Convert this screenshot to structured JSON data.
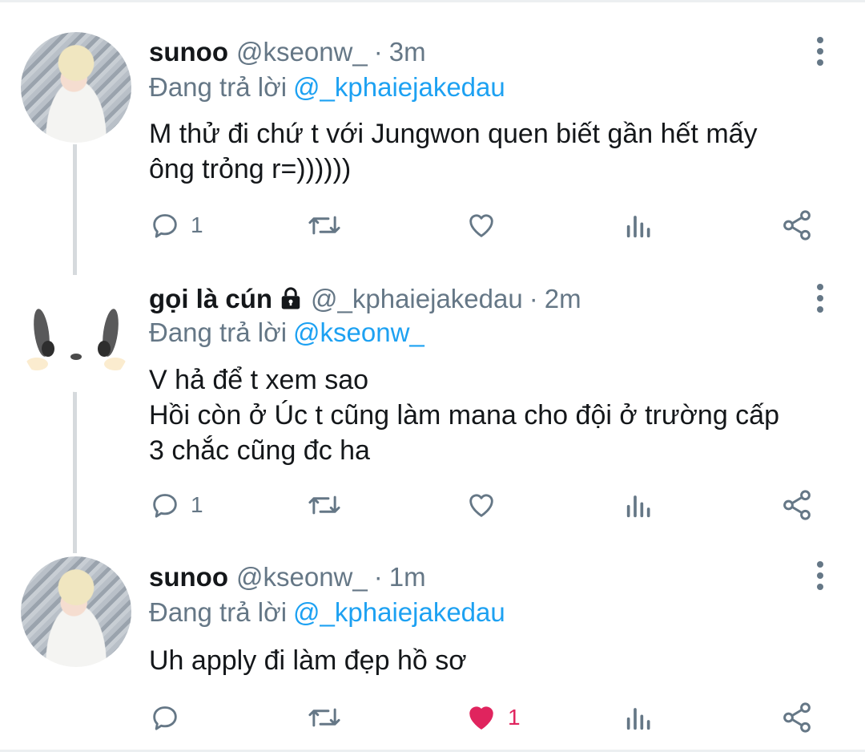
{
  "tweets": [
    {
      "name": "sunoo",
      "handle": "@kseonw_",
      "time": "3m",
      "reply_prefix": "Đang trả lời",
      "reply_to": "@_kphaiejakedau",
      "body_lines": [
        "M thử đi chứ t với Jungwon quen biết gần hết mấy",
        "ông trỏng r=))))))"
      ],
      "reply_count": "1",
      "like_count": "",
      "liked": false,
      "locked": false
    },
    {
      "name": "gọi là cún",
      "handle": "@_kphaiejakedau",
      "time": "2m",
      "reply_prefix": "Đang trả lời",
      "reply_to": "@kseonw_",
      "body_lines": [
        "V hả để t xem sao",
        "Hồi còn ở Úc t cũng làm mana cho đội ở trường cấp",
        "3 chắc cũng đc ha"
      ],
      "reply_count": "1",
      "like_count": "",
      "liked": false,
      "locked": true
    },
    {
      "name": "sunoo",
      "handle": "@kseonw_",
      "time": "1m",
      "reply_prefix": "Đang trả lời",
      "reply_to": "@_kphaiejakedau",
      "body_lines": [
        "Uh apply đi làm đẹp hồ sơ"
      ],
      "reply_count": "",
      "like_count": "1",
      "liked": true,
      "locked": false
    }
  ],
  "separator": "·",
  "icons": {
    "reply": "reply-icon",
    "retweet": "retweet-icon",
    "like": "heart-icon",
    "analytics": "analytics-icon",
    "share": "share-icon",
    "more": "more-vertical-icon",
    "lock": "lock-icon"
  },
  "colors": {
    "text": "#14171a",
    "muted": "#657786",
    "link": "#1da1f2",
    "like": "#e0245e",
    "thread_line": "#d6dadd"
  }
}
